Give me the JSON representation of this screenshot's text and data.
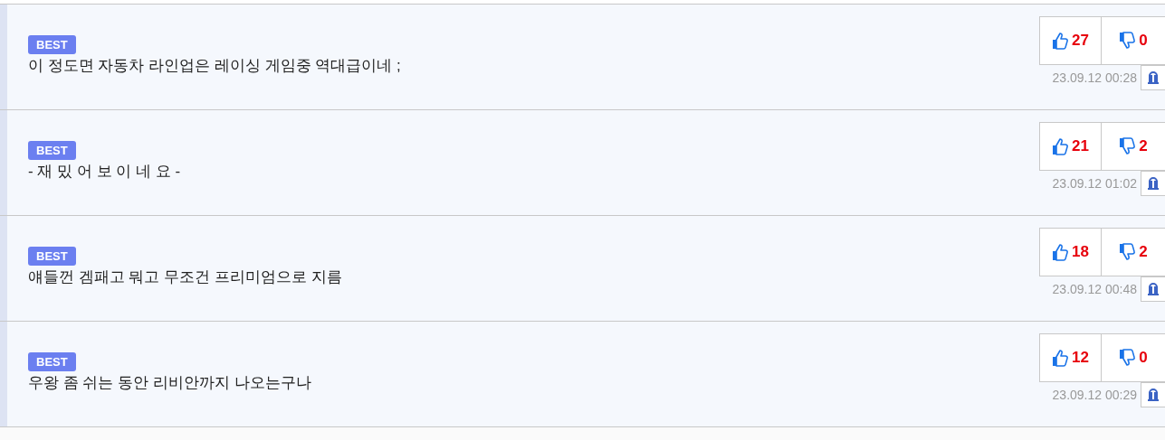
{
  "comments": [
    {
      "badge": "BEST",
      "text": "이 정도면 자동차 라인업은 레이싱 게임중 역대급이네 ;",
      "likes": "27",
      "dislikes": "0",
      "date": "23.09.12 00:28"
    },
    {
      "badge": "BEST",
      "text": "- 재 밌 어 보 이 네 요 -",
      "likes": "21",
      "dislikes": "2",
      "date": "23.09.12 01:02"
    },
    {
      "badge": "BEST",
      "text": "얘들껀 겜패고 뭐고 무조건 프리미엄으로 지름",
      "likes": "18",
      "dislikes": "2",
      "date": "23.09.12 00:48"
    },
    {
      "badge": "BEST",
      "text": "우왕 좀 쉬는 동안 리비안까지 나오는구나",
      "likes": "12",
      "dislikes": "0",
      "date": "23.09.12 00:29"
    }
  ]
}
